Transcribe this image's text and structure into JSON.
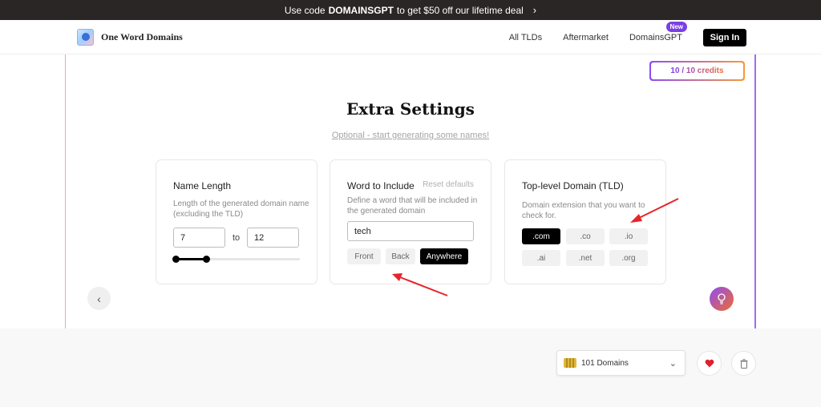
{
  "promo": {
    "text_before": "Use code",
    "code": "DOMAINSGPT",
    "text_after": "to get $50 off our lifetime deal",
    "chevron_icon": "chevron-right-icon"
  },
  "header": {
    "logo_text": "One Word Domains",
    "nav_links": [
      "All TLDs",
      "Aftermarket",
      "DomainsGPT"
    ],
    "new_badge": "New",
    "signin_label": "Sign In"
  },
  "credits": {
    "label": "10 / 10 credits"
  },
  "main": {
    "title": "Extra Settings",
    "subtitle": "Optional - start generating some names!"
  },
  "name_length": {
    "title": "Name Length",
    "description": "Length of the generated domain name (excluding the TLD)",
    "min_value": "7",
    "to_label": "to",
    "max_value": "12"
  },
  "word_include": {
    "title": "Word to Include",
    "reset_label": "Reset defaults",
    "description": "Define a word that will be included in the generated domain",
    "input_value": "tech",
    "positions": [
      "Front",
      "Back",
      "Anywhere"
    ],
    "selected_position": "Anywhere"
  },
  "tld": {
    "title": "Top-level Domain (TLD)",
    "description": "Domain extension that you want to check for.",
    "options": [
      ".com",
      ".co",
      ".io",
      ".ai",
      ".net",
      ".org"
    ],
    "selected": ".com"
  },
  "footer": {
    "domains_label": "101 Domains",
    "heart_icon": "heart-icon",
    "trash_icon": "trash-icon"
  },
  "colors": {
    "accent_purple": "#8d4df5",
    "accent_orange": "#f06b2e",
    "annotation_red": "#e8242a"
  }
}
